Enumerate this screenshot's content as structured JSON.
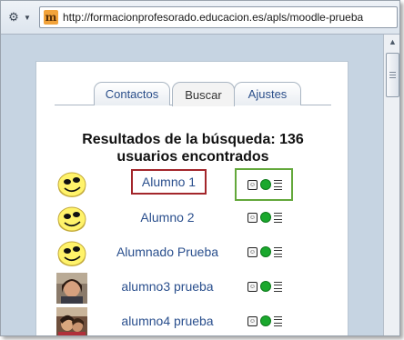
{
  "browser": {
    "url": "http://formacionprofesorado.educacion.es/apls/moodle-prueba",
    "favicon_letter": "m"
  },
  "tabs": [
    {
      "label": "Contactos",
      "active": false
    },
    {
      "label": "Buscar",
      "active": true
    },
    {
      "label": "Ajustes",
      "active": false
    }
  ],
  "results": {
    "title_line1": "Resultados de la búsqueda: 136",
    "title_line2": "usuarios encontrados"
  },
  "users": [
    {
      "name": "Alumno 1",
      "avatar": "smiley",
      "highlighted": true
    },
    {
      "name": "Alumno 2",
      "avatar": "smiley",
      "highlighted": false
    },
    {
      "name": "Alumnado Prueba",
      "avatar": "smiley",
      "highlighted": false
    },
    {
      "name": "alumno3 prueba",
      "avatar": "photo",
      "highlighted": false
    },
    {
      "name": "alumno4 prueba",
      "avatar": "photo",
      "highlighted": false
    }
  ],
  "icons": {
    "profile": "profile-icon",
    "add_contact": "add-contact-icon",
    "history": "message-history-icon"
  },
  "colors": {
    "highlight_name_border": "#a3262b",
    "highlight_icons_border": "#63a83b",
    "add_contact_green": "#1aa82d",
    "link_blue": "#2a4f8d"
  }
}
